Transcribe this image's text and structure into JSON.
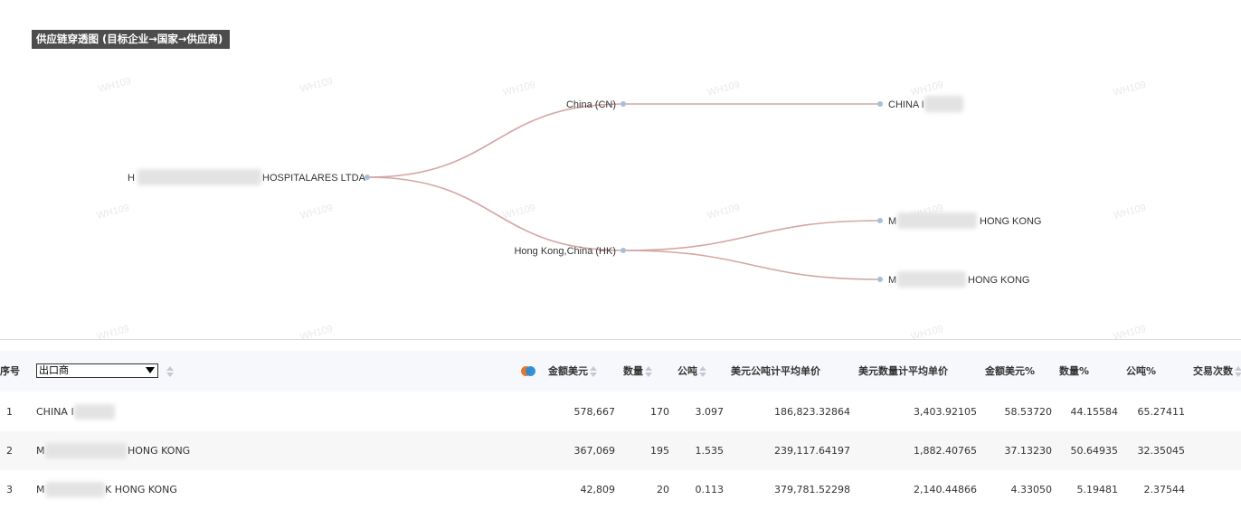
{
  "title": "供应链穿透图 (目标企业→国家→供应商)",
  "watermark": "WH109",
  "graph": {
    "root": {
      "prefix": "H",
      "suffix": "HOSPITALARES LTDA"
    },
    "countries": [
      "China (CN)",
      "Hong Kong,China (HK)"
    ],
    "suppliers": [
      {
        "prefix": "CHINA I",
        "suffix": ""
      },
      {
        "prefix": "M",
        "suffix": "HONG KONG"
      },
      {
        "prefix": "M",
        "suffix": "HONG KONG"
      }
    ],
    "edge_color": "#d4a5a5",
    "node_color": "#a9bdd9"
  },
  "table": {
    "headers": {
      "index": "序号",
      "select_value": "出口商",
      "amount_usd": "金额美元",
      "quantity": "数量",
      "tonnes": "公吨",
      "avg_usd_per_tonne": "美元公吨计平均单价",
      "avg_usd_per_qty": "美元数量计平均单价",
      "amount_pct": "金额美元%",
      "quantity_pct": "数量%",
      "tonnes_pct": "公吨%",
      "transactions": "交易次数"
    },
    "rows": [
      {
        "index": "1",
        "name_prefix": "CHINA I",
        "name_suffix": "",
        "amount_usd": "578,667",
        "quantity": "170",
        "tonnes": "3.097",
        "avg_usd_per_tonne": "186,823.32864",
        "avg_usd_per_qty": "3,403.92105",
        "amount_pct": "58.53720",
        "quantity_pct": "44.15584",
        "tonnes_pct": "65.27411",
        "transactions": ""
      },
      {
        "index": "2",
        "name_prefix": "M",
        "name_suffix": "HONG KONG",
        "amount_usd": "367,069",
        "quantity": "195",
        "tonnes": "1.535",
        "avg_usd_per_tonne": "239,117.64197",
        "avg_usd_per_qty": "1,882.40765",
        "amount_pct": "37.13230",
        "quantity_pct": "50.64935",
        "tonnes_pct": "32.35045",
        "transactions": ""
      },
      {
        "index": "3",
        "name_prefix": "M",
        "name_suffix": "K HONG KONG",
        "amount_usd": "42,809",
        "quantity": "20",
        "tonnes": "0.113",
        "avg_usd_per_tonne": "379,781.52298",
        "avg_usd_per_qty": "2,140.44866",
        "amount_pct": "4.33050",
        "quantity_pct": "5.19481",
        "tonnes_pct": "2.37544",
        "transactions": ""
      }
    ]
  }
}
